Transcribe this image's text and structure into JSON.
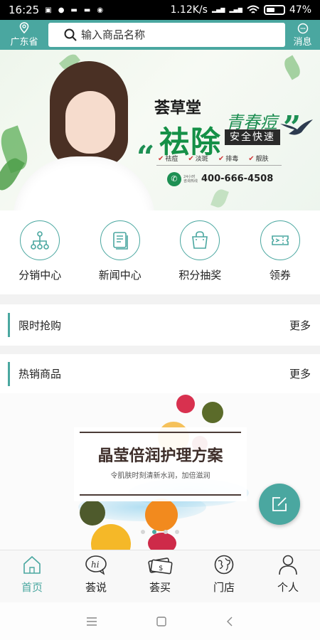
{
  "status_bar": {
    "time": "16:25",
    "net_speed": "1.12K/s",
    "battery": "47%"
  },
  "header": {
    "location": "广东省",
    "search_placeholder": "输入商品名称",
    "message": "消息"
  },
  "banner": {
    "brand": "荟草堂",
    "headline": "祛除",
    "acne": "青春痘",
    "badge": "安全快速",
    "features": [
      "祛痘",
      "淡斑",
      "排毒",
      "靓肤"
    ],
    "hotline": "400-666-4508",
    "hotline_label": "24小时咨询热线"
  },
  "quick_nav": [
    {
      "label": "分销中心",
      "icon": "distribution-icon"
    },
    {
      "label": "新闻中心",
      "icon": "news-icon"
    },
    {
      "label": "积分抽奖",
      "icon": "lottery-bag-icon"
    },
    {
      "label": "领券",
      "icon": "coupon-icon"
    }
  ],
  "sections": {
    "flash_sale": {
      "title": "限时抢购",
      "more": "更多"
    },
    "hot_products": {
      "title": "热销商品",
      "more": "更多"
    }
  },
  "product_banner": {
    "title": "晶莹倍润护理方案",
    "subtitle": "令肌肤时刻清新水润，加倍滋润",
    "active_slide": 1
  },
  "tab_bar": [
    {
      "label": "首页",
      "icon": "home-icon",
      "active": true
    },
    {
      "label": "荟说",
      "icon": "talk-icon",
      "active": false
    },
    {
      "label": "荟买",
      "icon": "buy-icon",
      "active": false
    },
    {
      "label": "门店",
      "icon": "globe-icon",
      "active": false
    },
    {
      "label": "个人",
      "icon": "person-icon",
      "active": false
    }
  ],
  "colors": {
    "accent": "#4aa7a0",
    "banner_green": "#159047"
  }
}
